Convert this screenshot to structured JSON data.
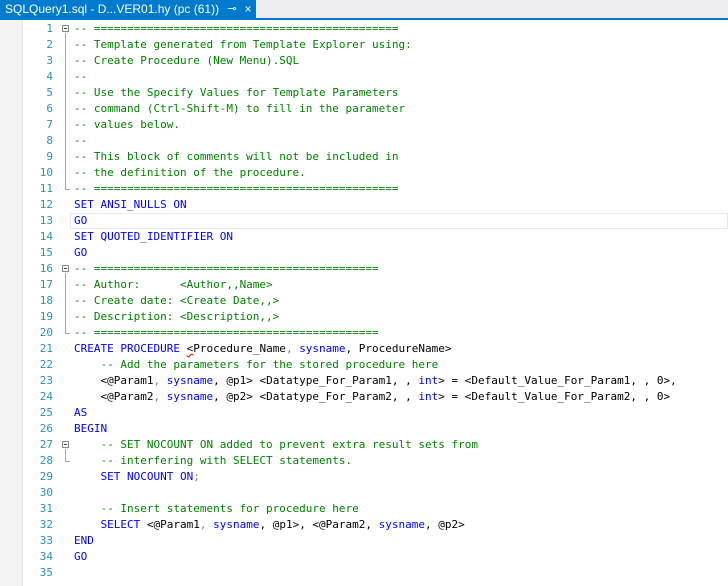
{
  "tab": {
    "title": "SQLQuery1.sql - D...VER01.hy (pc (61))",
    "pin_icon": "⊸",
    "close_icon": "×"
  },
  "colors": {
    "comment": "#008000",
    "keyword": "#0000ff",
    "line_number": "#2b91af",
    "tab_active": "#007acc"
  },
  "lines": [
    {
      "n": "1",
      "fold": "start",
      "tokens": [
        {
          "t": "-- ==============================================",
          "c": "comment"
        }
      ]
    },
    {
      "n": "2",
      "tokens": [
        {
          "t": "-- Template generated from Template Explorer using:",
          "c": "comment"
        }
      ]
    },
    {
      "n": "3",
      "tokens": [
        {
          "t": "-- Create Procedure (New Menu).SQL",
          "c": "comment"
        }
      ]
    },
    {
      "n": "4",
      "tokens": [
        {
          "t": "--",
          "c": "comment"
        }
      ]
    },
    {
      "n": "5",
      "tokens": [
        {
          "t": "-- Use the Specify Values for Template Parameters",
          "c": "comment"
        }
      ]
    },
    {
      "n": "6",
      "tokens": [
        {
          "t": "-- command (Ctrl-Shift-M) to fill in the parameter",
          "c": "comment"
        }
      ]
    },
    {
      "n": "7",
      "tokens": [
        {
          "t": "-- values below.",
          "c": "comment"
        }
      ]
    },
    {
      "n": "8",
      "tokens": [
        {
          "t": "--",
          "c": "comment"
        }
      ]
    },
    {
      "n": "9",
      "tokens": [
        {
          "t": "-- This block of comments will not be included in",
          "c": "comment"
        }
      ]
    },
    {
      "n": "10",
      "tokens": [
        {
          "t": "-- the definition of the procedure.",
          "c": "comment"
        }
      ]
    },
    {
      "n": "11",
      "fold": "end",
      "tokens": [
        {
          "t": "-- ==============================================",
          "c": "comment"
        }
      ]
    },
    {
      "n": "12",
      "tokens": [
        {
          "t": "SET ANSI_NULLS ON",
          "c": "keyword"
        }
      ]
    },
    {
      "n": "13",
      "tokens": [
        {
          "t": "GO",
          "c": "keyword"
        }
      ]
    },
    {
      "n": "14",
      "tokens": [
        {
          "t": "SET QUOTED_IDENTIFIER ON",
          "c": "keyword"
        }
      ]
    },
    {
      "n": "15",
      "tokens": [
        {
          "t": "GO",
          "c": "keyword"
        }
      ]
    },
    {
      "n": "16",
      "fold": "start",
      "tokens": [
        {
          "t": "-- ===========================================",
          "c": "comment"
        }
      ]
    },
    {
      "n": "17",
      "tokens": [
        {
          "t": "-- Author:      <Author,,Name>",
          "c": "comment"
        }
      ]
    },
    {
      "n": "18",
      "tokens": [
        {
          "t": "-- Create date: <Create Date,,>",
          "c": "comment"
        }
      ]
    },
    {
      "n": "19",
      "tokens": [
        {
          "t": "-- Description: <Description,,>",
          "c": "comment"
        }
      ]
    },
    {
      "n": "20",
      "fold": "end",
      "tokens": [
        {
          "t": "-- ===========================================",
          "c": "comment"
        }
      ]
    },
    {
      "n": "21",
      "tokens": [
        {
          "t": "CREATE PROCEDURE ",
          "c": "keyword"
        },
        {
          "t": "<",
          "c": "squig"
        },
        {
          "t": "Procedure_Name",
          "c": "plain"
        },
        {
          "t": ", ",
          "c": "punct"
        },
        {
          "t": "sysname",
          "c": "sys"
        },
        {
          "t": ", ProcedureName>",
          "c": "plain"
        }
      ]
    },
    {
      "n": "22",
      "tokens": [
        {
          "t": "    -- Add the parameters for the stored procedure here",
          "c": "comment"
        }
      ]
    },
    {
      "n": "23",
      "tokens": [
        {
          "t": "    <@Param1",
          "c": "plain"
        },
        {
          "t": ", ",
          "c": "punct"
        },
        {
          "t": "sysname",
          "c": "sys"
        },
        {
          "t": ", @p1> <Datatype_For_Param1, , ",
          "c": "plain"
        },
        {
          "t": "int",
          "c": "sys"
        },
        {
          "t": "> = <Default_Value_For_Param1, , 0>,",
          "c": "plain"
        }
      ]
    },
    {
      "n": "24",
      "tokens": [
        {
          "t": "    <@Param2",
          "c": "plain"
        },
        {
          "t": ", ",
          "c": "punct"
        },
        {
          "t": "sysname",
          "c": "sys"
        },
        {
          "t": ", @p2> <Datatype_For_Param2, , ",
          "c": "plain"
        },
        {
          "t": "int",
          "c": "sys"
        },
        {
          "t": "> = <Default_Value_For_Param2, , 0>",
          "c": "plain"
        }
      ]
    },
    {
      "n": "25",
      "tokens": [
        {
          "t": "AS",
          "c": "keyword"
        }
      ]
    },
    {
      "n": "26",
      "tokens": [
        {
          "t": "BEGIN",
          "c": "keyword"
        }
      ]
    },
    {
      "n": "27",
      "fold": "start",
      "tokens": [
        {
          "t": "    -- SET NOCOUNT ON added to prevent extra result sets from",
          "c": "comment"
        }
      ]
    },
    {
      "n": "28",
      "fold": "end",
      "tokens": [
        {
          "t": "    -- interfering with SELECT statements.",
          "c": "comment"
        }
      ]
    },
    {
      "n": "29",
      "tokens": [
        {
          "t": "    SET NOCOUNT ON",
          "c": "keyword"
        },
        {
          "t": ";",
          "c": "punct"
        }
      ]
    },
    {
      "n": "30",
      "tokens": [
        {
          "t": "",
          "c": "plain"
        }
      ]
    },
    {
      "n": "31",
      "tokens": [
        {
          "t": "    -- Insert statements for procedure here",
          "c": "comment"
        }
      ]
    },
    {
      "n": "32",
      "tokens": [
        {
          "t": "    SELECT ",
          "c": "keyword"
        },
        {
          "t": "<@Param1",
          "c": "plain"
        },
        {
          "t": ", ",
          "c": "punct"
        },
        {
          "t": "sysname",
          "c": "sys"
        },
        {
          "t": ", @p1>, <@Param2, ",
          "c": "plain"
        },
        {
          "t": "sysname",
          "c": "sys"
        },
        {
          "t": ", @p2>",
          "c": "plain"
        }
      ]
    },
    {
      "n": "33",
      "tokens": [
        {
          "t": "END",
          "c": "keyword"
        }
      ]
    },
    {
      "n": "34",
      "tokens": [
        {
          "t": "GO",
          "c": "keyword"
        }
      ]
    },
    {
      "n": "35",
      "tokens": [
        {
          "t": "",
          "c": "plain"
        }
      ]
    }
  ]
}
